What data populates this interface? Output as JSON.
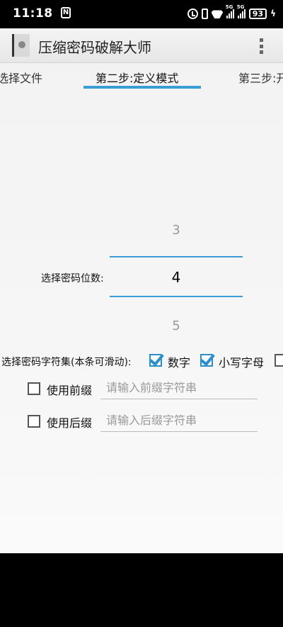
{
  "status_bar": {
    "time": "11:18",
    "n_icon": "N",
    "signal_label": "5G",
    "battery": "93"
  },
  "app": {
    "title": "压缩密码破解大师"
  },
  "tabs": [
    {
      "label": "选择文件"
    },
    {
      "label": "第二步:定义模式"
    },
    {
      "label": "第三步:开"
    }
  ],
  "picker": {
    "label": "选择密码位数:",
    "prev": "3",
    "current": "4",
    "next": "5"
  },
  "charset": {
    "label": "选择密码字符集(本条可滑动):",
    "digits_label": "数字",
    "digits_checked": true,
    "lower_label": "小写字母",
    "lower_checked": true
  },
  "prefix": {
    "label": "使用前缀",
    "placeholder": "请输入前缀字符串",
    "checked": false
  },
  "suffix": {
    "label": "使用后缀",
    "placeholder": "请输入后缀字符串",
    "checked": false
  }
}
